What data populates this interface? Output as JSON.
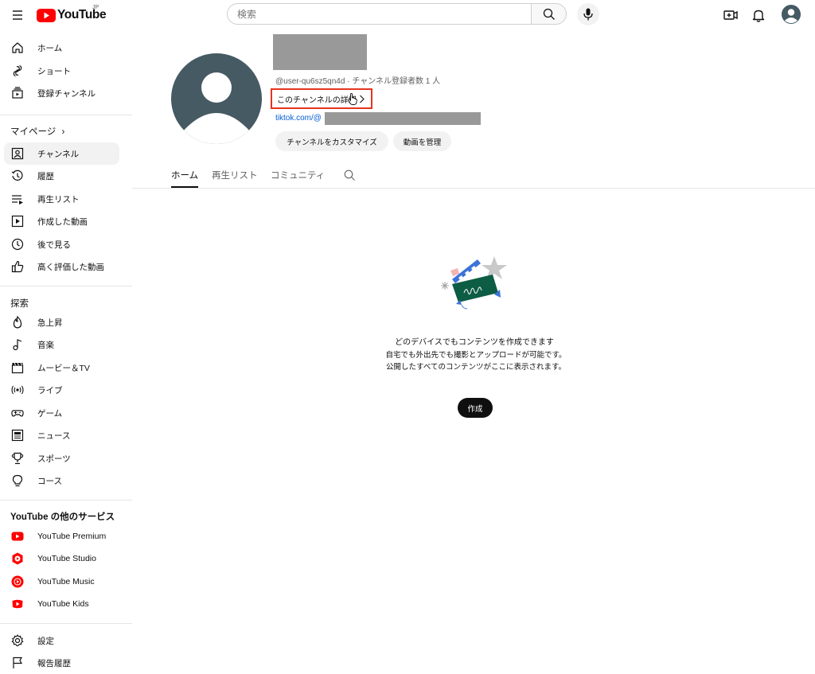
{
  "header": {
    "logo_text": "YouTube",
    "region": "JP",
    "search_placeholder": "検索"
  },
  "sidebar": {
    "main": [
      {
        "label": "ホーム",
        "icon": "home-icon"
      },
      {
        "label": "ショート",
        "icon": "shorts-icon"
      },
      {
        "label": "登録チャンネル",
        "icon": "subscriptions-icon"
      }
    ],
    "you_title": "マイページ",
    "you_items": [
      {
        "label": "チャンネル",
        "icon": "channel-icon",
        "active": true
      },
      {
        "label": "履歴",
        "icon": "history-icon"
      },
      {
        "label": "再生リスト",
        "icon": "playlist-icon"
      },
      {
        "label": "作成した動画",
        "icon": "your-videos-icon"
      },
      {
        "label": "後で見る",
        "icon": "watch-later-icon"
      },
      {
        "label": "高く評価した動画",
        "icon": "like-icon"
      }
    ],
    "explore_title": "探索",
    "explore_items": [
      {
        "label": "急上昇",
        "icon": "trending-icon"
      },
      {
        "label": "音楽",
        "icon": "music-icon"
      },
      {
        "label": "ムービー＆TV",
        "icon": "movies-icon"
      },
      {
        "label": "ライブ",
        "icon": "live-icon"
      },
      {
        "label": "ゲーム",
        "icon": "gaming-icon"
      },
      {
        "label": "ニュース",
        "icon": "news-icon"
      },
      {
        "label": "スポーツ",
        "icon": "sports-icon"
      },
      {
        "label": "コース",
        "icon": "courses-icon"
      }
    ],
    "more_title": "YouTube の他のサービス",
    "more_items": [
      {
        "label": "YouTube Premium",
        "icon": "youtube-premium-icon"
      },
      {
        "label": "YouTube Studio",
        "icon": "youtube-studio-icon"
      },
      {
        "label": "YouTube Music",
        "icon": "youtube-music-icon"
      },
      {
        "label": "YouTube Kids",
        "icon": "youtube-kids-icon"
      }
    ],
    "settings": [
      {
        "label": "設定",
        "icon": "settings-icon"
      },
      {
        "label": "報告履歴",
        "icon": "report-history-icon"
      }
    ]
  },
  "channel": {
    "meta": "@user-qu6sz5qn4d · チャンネル登録者数 1 人",
    "details_link": "このチャンネルの詳細",
    "link_prefix": "tiktok.com/@",
    "customize_button": "チャンネルをカスタマイズ",
    "manage_button": "動画を管理"
  },
  "tabs": [
    {
      "label": "ホーム",
      "active": true
    },
    {
      "label": "再生リスト"
    },
    {
      "label": "コミュニティ"
    }
  ],
  "empty_state": {
    "title": "どのデバイスでもコンテンツを作成できます",
    "description": "自宅でも外出先でも撮影とアップロードが可能です。公開したすべてのコンテンツがここに表示されます。",
    "button": "作成"
  },
  "colors": {
    "brand_red": "#ff0000",
    "highlight_box": "#e5341f",
    "link_blue": "#065fd4",
    "avatar_bg": "#465a64"
  }
}
